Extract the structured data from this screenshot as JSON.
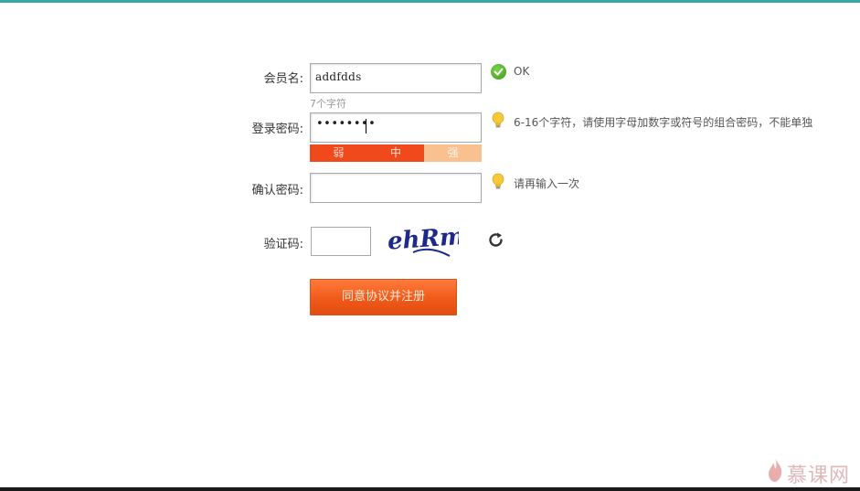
{
  "form": {
    "username": {
      "label": "会员名:",
      "value": "addfdds",
      "counter": "7个字符",
      "status": "OK"
    },
    "password": {
      "label": "登录密码:",
      "masked_value": "••••••••",
      "hint": "6-16个字符，请使用字母加数字或符号的组合密码，不能单独",
      "strength": [
        "弱",
        "中",
        "强"
      ]
    },
    "confirm": {
      "label": "确认密码:",
      "value": "",
      "hint": "请再输入一次"
    },
    "captcha": {
      "label": "验证码:",
      "value": "",
      "image_text": "ehRm"
    },
    "submit_label": "同意协议并注册"
  },
  "watermark": {
    "text": "慕课网"
  },
  "colors": {
    "top_bar": "#3aa7a6",
    "button": "#f05a1a",
    "strength_active": "#f04a1c",
    "strength_inactive": "#f9c090",
    "ok_green": "#4caf26",
    "hint_bulb": "#f2c230"
  },
  "icons": {
    "ok": "check-circle-icon",
    "hint": "lightbulb-icon",
    "refresh": "refresh-icon"
  }
}
